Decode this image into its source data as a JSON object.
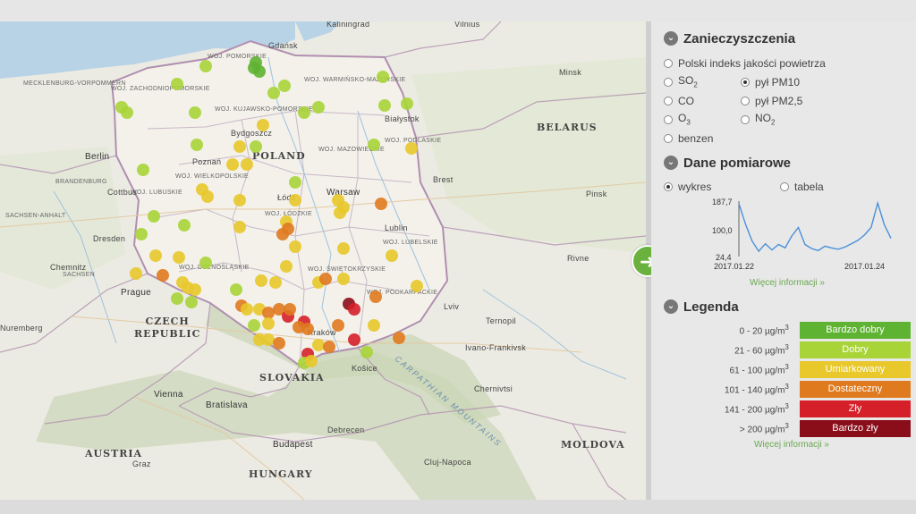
{
  "map": {
    "countries": [
      {
        "id": "poland",
        "label": "POLAND"
      },
      {
        "id": "belarus",
        "label": "BELARUS"
      },
      {
        "id": "czech",
        "label": "CZECH\nREPUBLIC"
      },
      {
        "id": "slovakia",
        "label": "SLOVAKIA"
      },
      {
        "id": "austria",
        "label": "AUSTRIA"
      },
      {
        "id": "hungary",
        "label": "HUNGARY"
      },
      {
        "id": "moldova",
        "label": "MOLDOVA"
      }
    ],
    "voivodeships": [
      "WOJ. POMORSKIE",
      "WOJ. WARMIŃSKO-MAZURSKIE",
      "WOJ. KUJAWSKO-POMORSKIE",
      "WOJ. MAZOWIECKIE",
      "WOJ. PODLASKIE",
      "WOJ. WIELKOPOLSKIE",
      "WOJ. LUBUSKIE",
      "WOJ. ŁÓDZKIE",
      "WOJ. LUBELSKIE",
      "WOJ. ŚWIĘTOKRZYSKIE",
      "WOJ. PODKARPACKIE",
      "WOJ. ZACHODNIOPOMORSKIE",
      "WOJ. DOLNOŚLĄSKIE"
    ],
    "cities": [
      "Kaliningrad",
      "Vilnius",
      "Gdańsk",
      "Minsk",
      "Białystok",
      "Warsaw",
      "Bydgoszcz",
      "Poznań",
      "Berlin",
      "Łódź",
      "Brest",
      "Lublin",
      "Dresden",
      "Prague",
      "Lviv",
      "Kraków",
      "Košice",
      "Vienna",
      "Bratislava",
      "Budapest",
      "Debrecen",
      "Chernivtsi",
      "Ternopil",
      "Ivano-Frankivsk",
      "Cluj-Napoca",
      "Graz",
      "Pinsk",
      "Rivne",
      "Nuremberg",
      "Chemnitz",
      "Cottbus"
    ],
    "region_labels": [
      "SACHSEN",
      "BRANDENBURG",
      "SACHSEN-ANHALT",
      "MECKLENBURG-VORPOMMERN",
      "CARPATHIAN MOUNTAINS"
    ],
    "station_colors": {
      "bardzo_dobry": "#5fb332",
      "dobry": "#a8d437",
      "umiarkowany": "#e8c82b",
      "dostateczny": "#e07a1f",
      "zly": "#d5202a",
      "bardzo_zly": "#8a0d1a"
    },
    "next_icon": "arrow-right-icon"
  },
  "panel": {
    "pollutants": {
      "title": "Zanieczyszczenia",
      "options": [
        {
          "id": "index",
          "label": "Polski indeks jakości powietrza",
          "checked": false
        },
        {
          "id": "so2",
          "label": "SO",
          "sub": "2",
          "checked": false
        },
        {
          "id": "pm10",
          "label": "pył PM10",
          "checked": true
        },
        {
          "id": "co",
          "label": "CO",
          "checked": false
        },
        {
          "id": "pm25",
          "label": "pył PM2,5",
          "checked": false
        },
        {
          "id": "o3",
          "label": "O",
          "sub": "3",
          "checked": false
        },
        {
          "id": "no2",
          "label": "NO",
          "sub": "2",
          "checked": false
        },
        {
          "id": "benzen",
          "label": "benzen",
          "checked": false
        }
      ]
    },
    "measurements": {
      "title": "Dane pomiarowe",
      "view_options": [
        {
          "id": "wykres",
          "label": "wykres",
          "checked": true
        },
        {
          "id": "tabela",
          "label": "tabela",
          "checked": false
        }
      ],
      "more_link": "Więcej informacji »"
    },
    "chart_data": {
      "type": "line",
      "y_ticks": [
        "187,7",
        "100,0",
        "24,4"
      ],
      "ylim": [
        24.4,
        187.7
      ],
      "x_ticks": [
        "2017.01.22",
        "2017.01.24"
      ],
      "line_color": "#4a90d9",
      "values": [
        180,
        120,
        70,
        40,
        62,
        44,
        60,
        50,
        85,
        110,
        60,
        48,
        42,
        55,
        50,
        46,
        52,
        62,
        72,
        88,
        110,
        182,
        118,
        78
      ]
    },
    "legend": {
      "title": "Legenda",
      "unit": "µg/m",
      "unit_sup": "3",
      "rows": [
        {
          "range": "0 - 20",
          "label": "Bardzo dobry",
          "color": "#5fb332"
        },
        {
          "range": "21 - 60",
          "label": "Dobry",
          "color": "#a8d437"
        },
        {
          "range": "61 - 100",
          "label": "Umiarkowany",
          "color": "#e8c82b"
        },
        {
          "range": "101 - 140",
          "label": "Dostateczny",
          "color": "#e07a1f"
        },
        {
          "range": "141 - 200",
          "label": "Zły",
          "color": "#d5202a"
        },
        {
          "range": "> 200",
          "label": "Bardzo zły",
          "color": "#8a0d1a"
        }
      ],
      "more_link": "Więcej informacji »"
    }
  }
}
